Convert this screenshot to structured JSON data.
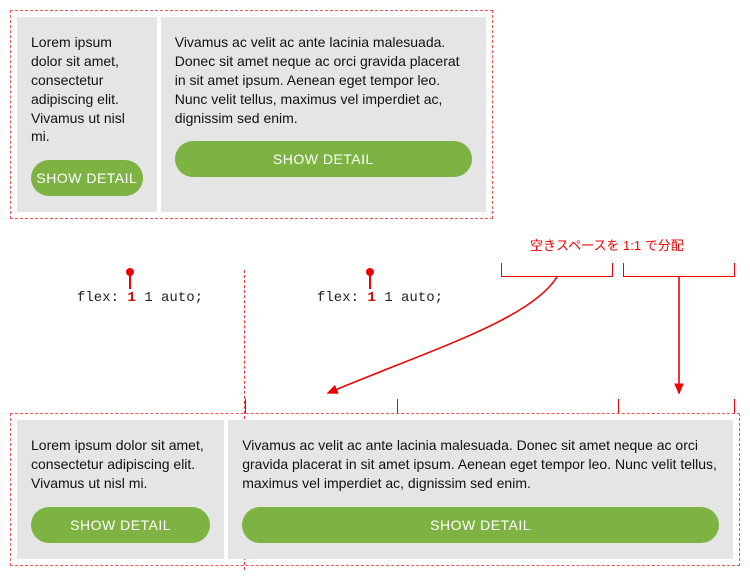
{
  "top": {
    "cards": [
      {
        "text": "Lorem ipsum dolor sit amet, consectetur adipiscing elit. Vivamus ut nisl mi.",
        "button": "SHOW DETAIL"
      },
      {
        "text": "Vivamus ac velit ac ante lacinia malesuada. Donec sit amet neque ac orci gravida placerat in sit amet ipsum. Aenean eget tempor leo. Nunc velit tellus, maximus vel imperdiet ac, dignissim sed enim.",
        "button": "SHOW DETAIL"
      }
    ]
  },
  "bottom": {
    "cards": [
      {
        "text": "Lorem ipsum dolor sit amet, consectetur adipiscing elit. Vivamus ut nisl mi.",
        "button": "SHOW DETAIL"
      },
      {
        "text": "Vivamus ac velit ac ante lacinia malesuada. Donec sit amet neque ac orci gravida placerat in sit amet ipsum. Aenean eget tempor leo. Nunc velit tellus, maximus vel imperdiet ac, dignissim sed enim.",
        "button": "SHOW DETAIL"
      }
    ]
  },
  "labels": {
    "flex1": "flex: ",
    "flexOne": "1",
    "flexRest": " 1 auto;",
    "spaceNote": "空きスペースを 1:1 で分配"
  }
}
